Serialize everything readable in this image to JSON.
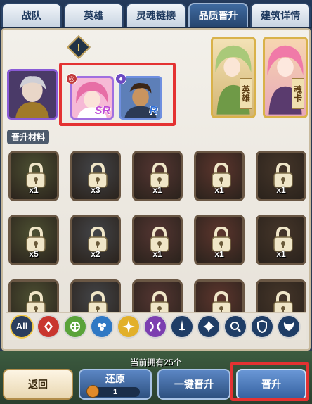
{
  "tabs": [
    {
      "label": "战队",
      "active": false
    },
    {
      "label": "英雄",
      "active": false
    },
    {
      "label": "灵魂链接",
      "active": false
    },
    {
      "label": "品质晋升",
      "active": true
    },
    {
      "label": "建筑详情",
      "active": false
    }
  ],
  "warning_icon": "exclamation-icon",
  "upgrade_slots": [
    {
      "rank": "SR"
    },
    {
      "rank": "R"
    }
  ],
  "cards": {
    "hero_tag": "英雄",
    "soul_tag": "魂卡"
  },
  "materials_label": "晋升材料",
  "materials": [
    {
      "count": "x1"
    },
    {
      "count": "x3"
    },
    {
      "count": "x1"
    },
    {
      "count": "x1"
    },
    {
      "count": "x1"
    },
    {
      "count": "x5"
    },
    {
      "count": "x2"
    },
    {
      "count": "x1"
    },
    {
      "count": "x1"
    },
    {
      "count": "x1"
    },
    {
      "count": ""
    },
    {
      "count": ""
    },
    {
      "count": ""
    },
    {
      "count": ""
    },
    {
      "count": ""
    }
  ],
  "filters": [
    {
      "label": "All",
      "icon": "all-filter-icon",
      "color": "#2b3e5e"
    },
    {
      "label": "",
      "icon": "fire-element-icon",
      "color": "#c9362f"
    },
    {
      "label": "",
      "icon": "wind-element-icon",
      "color": "#5aa33a"
    },
    {
      "label": "",
      "icon": "water-element-icon",
      "color": "#2f78c4"
    },
    {
      "label": "",
      "icon": "light-element-icon",
      "color": "#e2b02a"
    },
    {
      "label": "",
      "icon": "dark-element-icon",
      "color": "#7c3fb0"
    },
    {
      "label": "",
      "icon": "sword-class-icon",
      "color": "#1f3d66"
    },
    {
      "label": "",
      "icon": "shuriken-class-icon",
      "color": "#1f3d66"
    },
    {
      "label": "",
      "icon": "magnifier-class-icon",
      "color": "#1f3d66"
    },
    {
      "label": "",
      "icon": "shield-class-icon",
      "color": "#1f3d66"
    },
    {
      "label": "",
      "icon": "wing-class-icon",
      "color": "#1f3d66"
    }
  ],
  "owned_text": "当前拥有25个",
  "buttons": {
    "back": "返回",
    "restore": "还原",
    "restore_count": "1",
    "one_key": "一键晋升",
    "upgrade": "晋升"
  }
}
